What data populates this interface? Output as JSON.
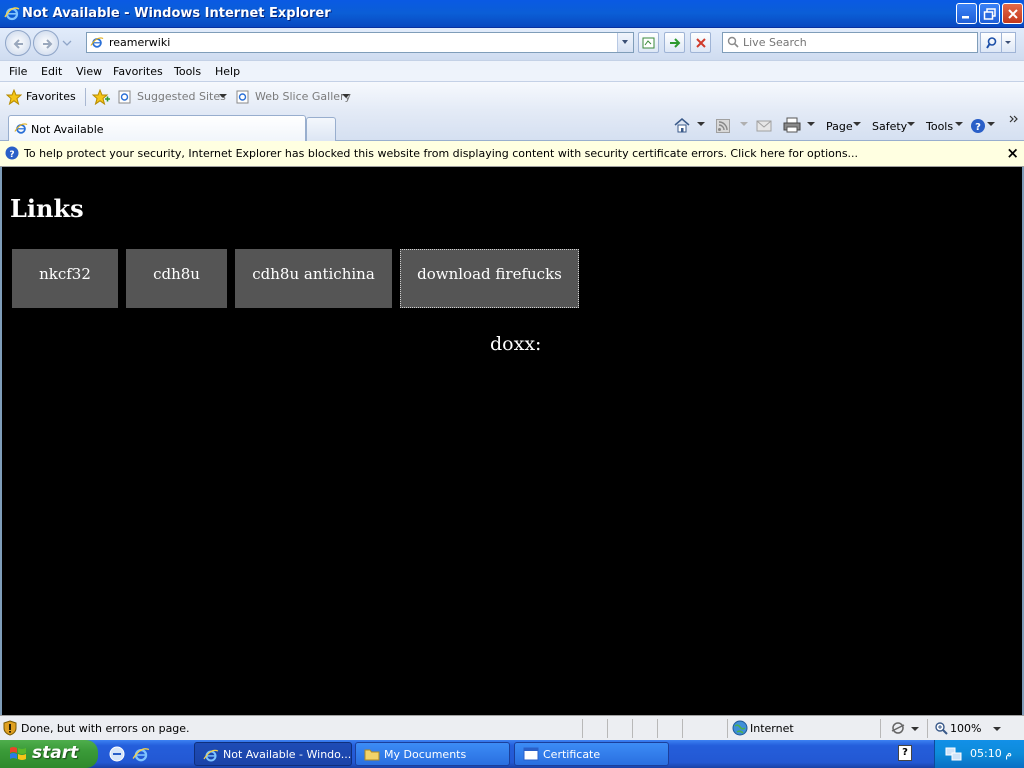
{
  "window": {
    "title": "Not Available - Windows Internet Explorer"
  },
  "address": {
    "url": "reamerwiki",
    "search_placeholder": "Live Search"
  },
  "menu": {
    "items": [
      "File",
      "Edit",
      "View",
      "Favorites",
      "Tools",
      "Help"
    ]
  },
  "favorites_bar": {
    "favorites_label": "Favorites",
    "suggested_sites": "Suggested Sites",
    "web_slice_gallery": "Web Slice Gallery"
  },
  "tab": {
    "label": "Not Available"
  },
  "command_bar": {
    "page": "Page",
    "safety": "Safety",
    "tools": "Tools"
  },
  "info_bar": {
    "message": "To help protect your security, Internet Explorer has blocked this website from displaying content with security certificate errors. Click here for options...",
    "close": "×"
  },
  "content": {
    "heading": "Links",
    "links": [
      "nkcf32",
      "cdh8u",
      "cdh8u antichina",
      "download firefucks"
    ],
    "doxx": "doxx:"
  },
  "status_bar": {
    "text": "Done, but with errors on page.",
    "zone": "Internet",
    "zoom": "100%"
  },
  "taskbar": {
    "start": "start",
    "buttons": [
      "Not Available - Windo...",
      "My Documents",
      "Certificate"
    ],
    "help": "?",
    "clock": "05:10 م"
  },
  "colors": {
    "content_bg": "#000000",
    "link_bg": "#555555",
    "titlebar": "#0b5ed6",
    "infobar": "#ffffe1"
  }
}
